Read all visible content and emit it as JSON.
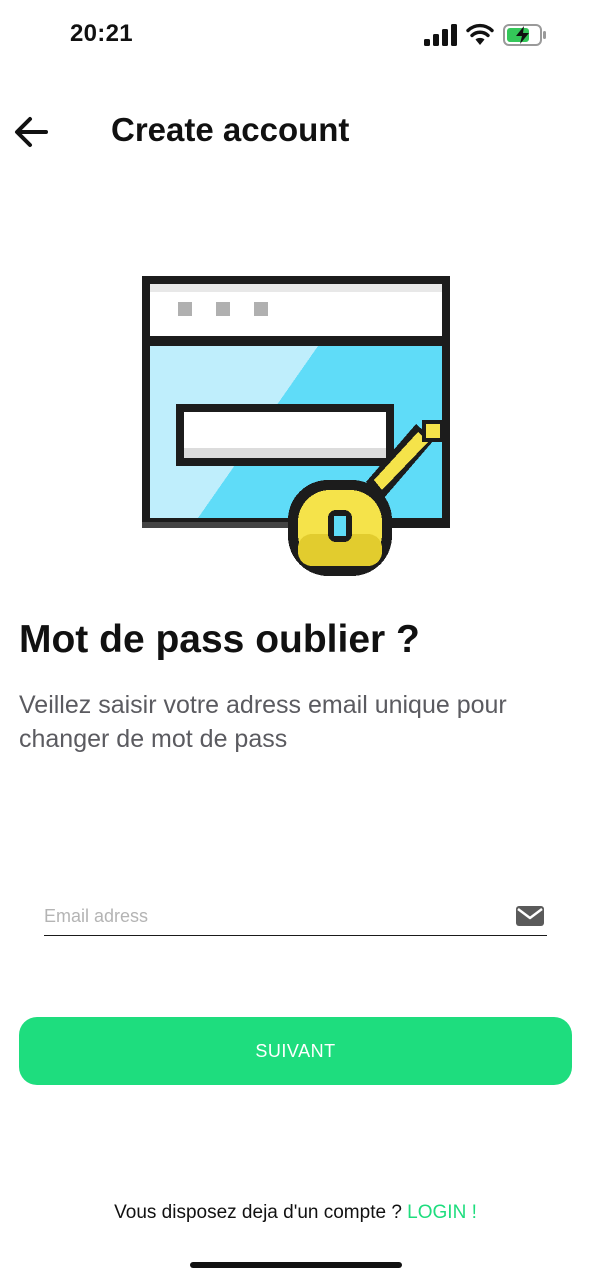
{
  "status_bar": {
    "time": "20:21",
    "signal_icon": "cellular-signal-icon",
    "wifi_icon": "wifi-icon",
    "battery_icon": "battery-charging-icon",
    "battery_color": "#34c759"
  },
  "nav": {
    "back_icon": "arrow-left-icon",
    "title": "Create account"
  },
  "illustration": {
    "icon": "browser-password-key-icon"
  },
  "content": {
    "headline": "Mot de pass oublier ?",
    "subtitle": "Veillez saisir votre adress email unique pour changer de mot de pass"
  },
  "form": {
    "email_value": "",
    "email_placeholder": "Email adress",
    "email_icon": "mail-icon",
    "submit_label": "SUIVANT"
  },
  "footer": {
    "text": "Vous disposez deja d'un compte ?",
    "link_label": "LOGIN !"
  },
  "colors": {
    "accent": "#1edd7e",
    "text": "#111111",
    "muted": "#5b5b60"
  }
}
